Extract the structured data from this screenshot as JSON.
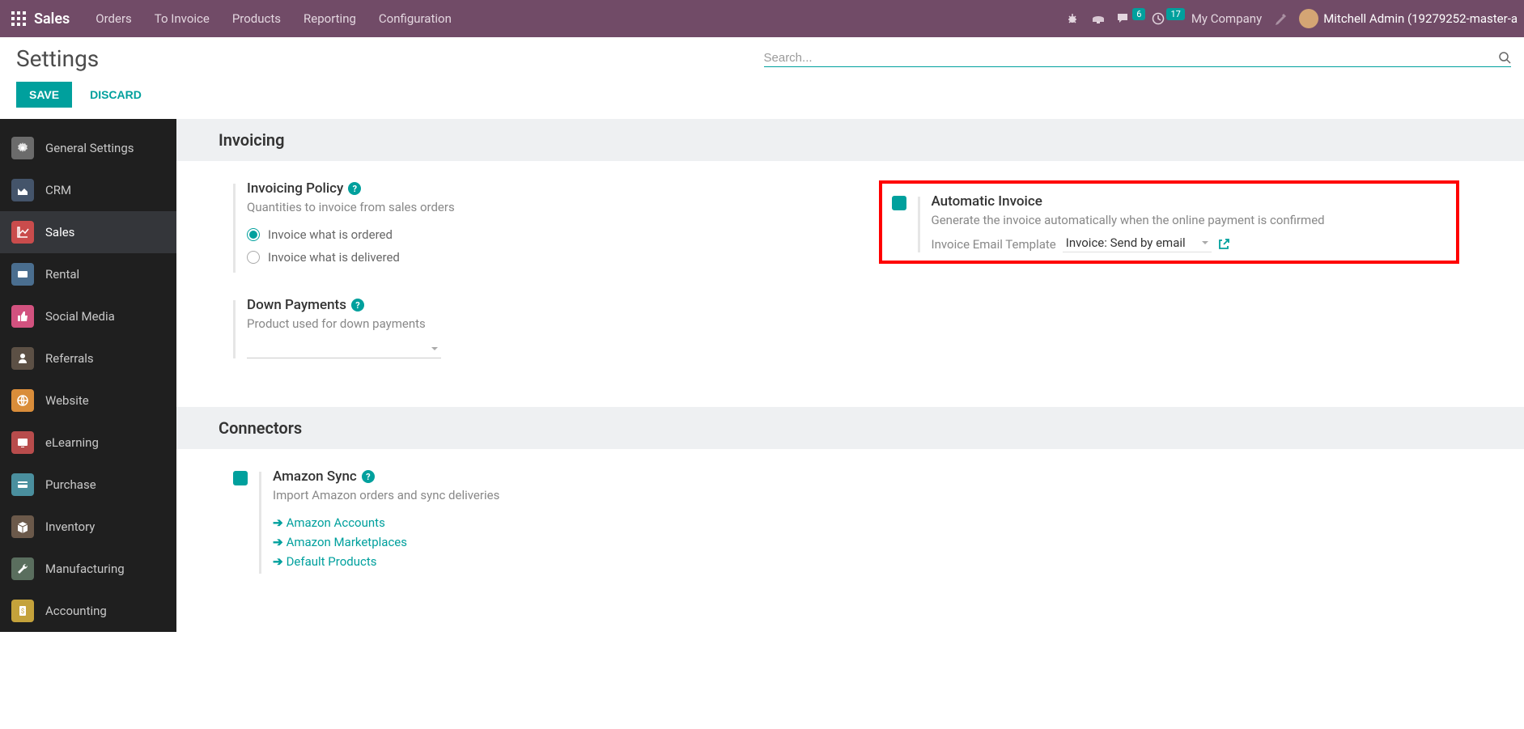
{
  "topnav": {
    "brand": "Sales",
    "items": [
      "Orders",
      "To Invoice",
      "Products",
      "Reporting",
      "Configuration"
    ],
    "messages_badge": "6",
    "activity_badge": "17",
    "company": "My Company",
    "user": "Mitchell Admin (19279252-master-a"
  },
  "control": {
    "title": "Settings",
    "search_placeholder": "Search...",
    "save": "SAVE",
    "discard": "DISCARD"
  },
  "sidebar": {
    "items": [
      {
        "label": "General Settings"
      },
      {
        "label": "CRM"
      },
      {
        "label": "Sales"
      },
      {
        "label": "Rental"
      },
      {
        "label": "Social Media"
      },
      {
        "label": "Referrals"
      },
      {
        "label": "Website"
      },
      {
        "label": "eLearning"
      },
      {
        "label": "Purchase"
      },
      {
        "label": "Inventory"
      },
      {
        "label": "Manufacturing"
      },
      {
        "label": "Accounting"
      }
    ]
  },
  "sections": {
    "invoicing": {
      "title": "Invoicing",
      "policy": {
        "label": "Invoicing Policy",
        "desc": "Quantities to invoice from sales orders",
        "option1": "Invoice what is ordered",
        "option2": "Invoice what is delivered"
      },
      "downpayments": {
        "label": "Down Payments",
        "desc": "Product used for down payments"
      },
      "autoinvoice": {
        "label": "Automatic Invoice",
        "desc": "Generate the invoice automatically when the online payment is confirmed",
        "template_label": "Invoice Email Template",
        "template_value": "Invoice: Send by email"
      }
    },
    "connectors": {
      "title": "Connectors",
      "amazon": {
        "label": "Amazon Sync",
        "desc": "Import Amazon orders and sync deliveries",
        "link1": "Amazon Accounts",
        "link2": "Amazon Marketplaces",
        "link3": "Default Products"
      }
    }
  }
}
